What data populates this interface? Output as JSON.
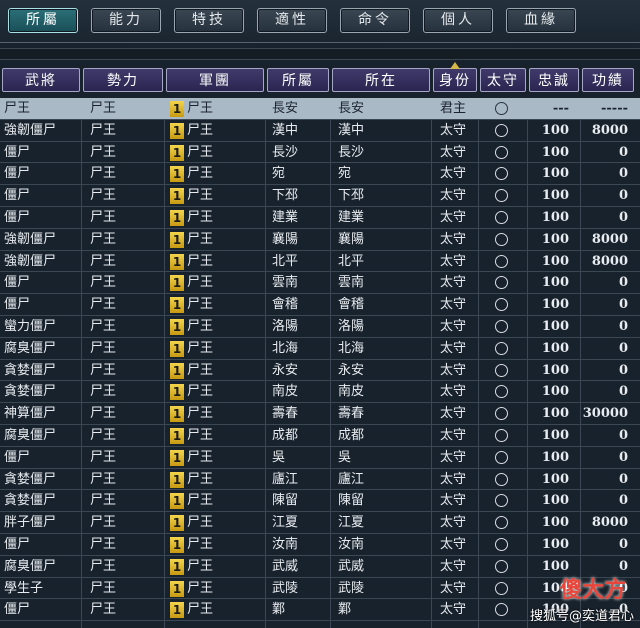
{
  "tabs": [
    {
      "label": "所屬",
      "active": true
    },
    {
      "label": "能力",
      "active": false
    },
    {
      "label": "特技",
      "active": false
    },
    {
      "label": "適性",
      "active": false
    },
    {
      "label": "命令",
      "active": false
    },
    {
      "label": "個人",
      "active": false
    },
    {
      "label": "血緣",
      "active": false
    }
  ],
  "columns": [
    "武將",
    "勢力",
    "軍團",
    "所屬",
    "所在",
    "身份",
    "太守",
    "忠誠",
    "功績"
  ],
  "rows": [
    {
      "name": "尸王",
      "force": "尸王",
      "corps_no": "1",
      "corps": "尸王",
      "belong": "長安",
      "location": "長安",
      "rank": "君主",
      "loyalty": "---",
      "merit": "-----",
      "selected": true
    },
    {
      "name": "強韌僵尸",
      "force": "尸王",
      "corps_no": "1",
      "corps": "尸王",
      "belong": "漢中",
      "location": "漢中",
      "rank": "太守",
      "loyalty": "100",
      "merit": "8000"
    },
    {
      "name": "僵尸",
      "force": "尸王",
      "corps_no": "1",
      "corps": "尸王",
      "belong": "長沙",
      "location": "長沙",
      "rank": "太守",
      "loyalty": "100",
      "merit": "0"
    },
    {
      "name": "僵尸",
      "force": "尸王",
      "corps_no": "1",
      "corps": "尸王",
      "belong": "宛",
      "location": "宛",
      "rank": "太守",
      "loyalty": "100",
      "merit": "0"
    },
    {
      "name": "僵尸",
      "force": "尸王",
      "corps_no": "1",
      "corps": "尸王",
      "belong": "下邳",
      "location": "下邳",
      "rank": "太守",
      "loyalty": "100",
      "merit": "0"
    },
    {
      "name": "僵尸",
      "force": "尸王",
      "corps_no": "1",
      "corps": "尸王",
      "belong": "建業",
      "location": "建業",
      "rank": "太守",
      "loyalty": "100",
      "merit": "0"
    },
    {
      "name": "強韌僵尸",
      "force": "尸王",
      "corps_no": "1",
      "corps": "尸王",
      "belong": "襄陽",
      "location": "襄陽",
      "rank": "太守",
      "loyalty": "100",
      "merit": "8000"
    },
    {
      "name": "強韌僵尸",
      "force": "尸王",
      "corps_no": "1",
      "corps": "尸王",
      "belong": "北平",
      "location": "北平",
      "rank": "太守",
      "loyalty": "100",
      "merit": "8000"
    },
    {
      "name": "僵尸",
      "force": "尸王",
      "corps_no": "1",
      "corps": "尸王",
      "belong": "雲南",
      "location": "雲南",
      "rank": "太守",
      "loyalty": "100",
      "merit": "0"
    },
    {
      "name": "僵尸",
      "force": "尸王",
      "corps_no": "1",
      "corps": "尸王",
      "belong": "會稽",
      "location": "會稽",
      "rank": "太守",
      "loyalty": "100",
      "merit": "0"
    },
    {
      "name": "蠻力僵尸",
      "force": "尸王",
      "corps_no": "1",
      "corps": "尸王",
      "belong": "洛陽",
      "location": "洛陽",
      "rank": "太守",
      "loyalty": "100",
      "merit": "0"
    },
    {
      "name": "腐臭僵尸",
      "force": "尸王",
      "corps_no": "1",
      "corps": "尸王",
      "belong": "北海",
      "location": "北海",
      "rank": "太守",
      "loyalty": "100",
      "merit": "0"
    },
    {
      "name": "貪婪僵尸",
      "force": "尸王",
      "corps_no": "1",
      "corps": "尸王",
      "belong": "永安",
      "location": "永安",
      "rank": "太守",
      "loyalty": "100",
      "merit": "0"
    },
    {
      "name": "貪婪僵尸",
      "force": "尸王",
      "corps_no": "1",
      "corps": "尸王",
      "belong": "南皮",
      "location": "南皮",
      "rank": "太守",
      "loyalty": "100",
      "merit": "0"
    },
    {
      "name": "神算僵尸",
      "force": "尸王",
      "corps_no": "1",
      "corps": "尸王",
      "belong": "壽春",
      "location": "壽春",
      "rank": "太守",
      "loyalty": "100",
      "merit": "30000"
    },
    {
      "name": "腐臭僵尸",
      "force": "尸王",
      "corps_no": "1",
      "corps": "尸王",
      "belong": "成都",
      "location": "成都",
      "rank": "太守",
      "loyalty": "100",
      "merit": "0"
    },
    {
      "name": "僵尸",
      "force": "尸王",
      "corps_no": "1",
      "corps": "尸王",
      "belong": "吳",
      "location": "吳",
      "rank": "太守",
      "loyalty": "100",
      "merit": "0"
    },
    {
      "name": "貪婪僵尸",
      "force": "尸王",
      "corps_no": "1",
      "corps": "尸王",
      "belong": "廬江",
      "location": "廬江",
      "rank": "太守",
      "loyalty": "100",
      "merit": "0"
    },
    {
      "name": "貪婪僵尸",
      "force": "尸王",
      "corps_no": "1",
      "corps": "尸王",
      "belong": "陳留",
      "location": "陳留",
      "rank": "太守",
      "loyalty": "100",
      "merit": "0"
    },
    {
      "name": "胖子僵尸",
      "force": "尸王",
      "corps_no": "1",
      "corps": "尸王",
      "belong": "江夏",
      "location": "江夏",
      "rank": "太守",
      "loyalty": "100",
      "merit": "8000"
    },
    {
      "name": "僵尸",
      "force": "尸王",
      "corps_no": "1",
      "corps": "尸王",
      "belong": "汝南",
      "location": "汝南",
      "rank": "太守",
      "loyalty": "100",
      "merit": "0"
    },
    {
      "name": "腐臭僵尸",
      "force": "尸王",
      "corps_no": "1",
      "corps": "尸王",
      "belong": "武威",
      "location": "武威",
      "rank": "太守",
      "loyalty": "100",
      "merit": "0"
    },
    {
      "name": "學生子",
      "force": "尸王",
      "corps_no": "1",
      "corps": "尸王",
      "belong": "武陵",
      "location": "武陵",
      "rank": "太守",
      "loyalty": "100",
      "merit": "0"
    },
    {
      "name": "僵尸",
      "force": "尸王",
      "corps_no": "1",
      "corps": "尸王",
      "belong": "鄴",
      "location": "鄴",
      "rank": "太守",
      "loyalty": "100",
      "merit": "0"
    }
  ],
  "watermark": {
    "logo": "傻大方",
    "text": "搜狐号@奕道君心"
  }
}
